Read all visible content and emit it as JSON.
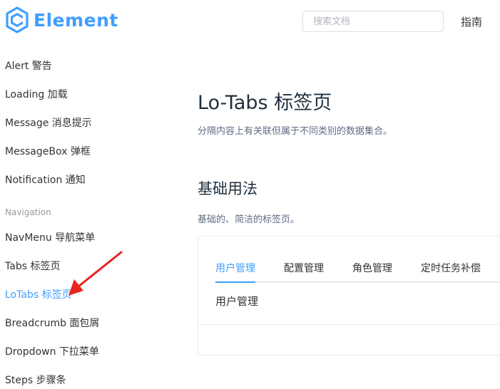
{
  "header": {
    "brand": "Element",
    "search_placeholder": "搜索文档",
    "guide_label": "指南"
  },
  "sidebar": {
    "items_top": [
      {
        "label": "Alert 警告"
      },
      {
        "label": "Loading 加载"
      },
      {
        "label": "Message 消息提示"
      },
      {
        "label": "MessageBox 弹框"
      },
      {
        "label": "Notification 通知"
      }
    ],
    "group_label": "Navigation",
    "items_nav": [
      {
        "label": "NavMenu 导航菜单"
      },
      {
        "label": "Tabs 标签页"
      },
      {
        "label": "LoTabs 标签页",
        "active": true
      },
      {
        "label": "Breadcrumb 面包屑"
      },
      {
        "label": "Dropdown 下拉菜单"
      },
      {
        "label": "Steps 步骤条"
      }
    ]
  },
  "main": {
    "title": "Lo-Tabs 标签页",
    "description": "分隔内容上有关联但属于不同类别的数据集合。",
    "section_title": "基础用法",
    "section_description": "基础的、简洁的标签页。",
    "demo": {
      "tabs": [
        {
          "label": "用户管理",
          "active": true
        },
        {
          "label": "配置管理"
        },
        {
          "label": "角色管理"
        },
        {
          "label": "定时任务补偿"
        }
      ],
      "content": "用户管理"
    }
  },
  "colors": {
    "accent": "#409eff",
    "annotation_arrow": "#e8231e"
  }
}
